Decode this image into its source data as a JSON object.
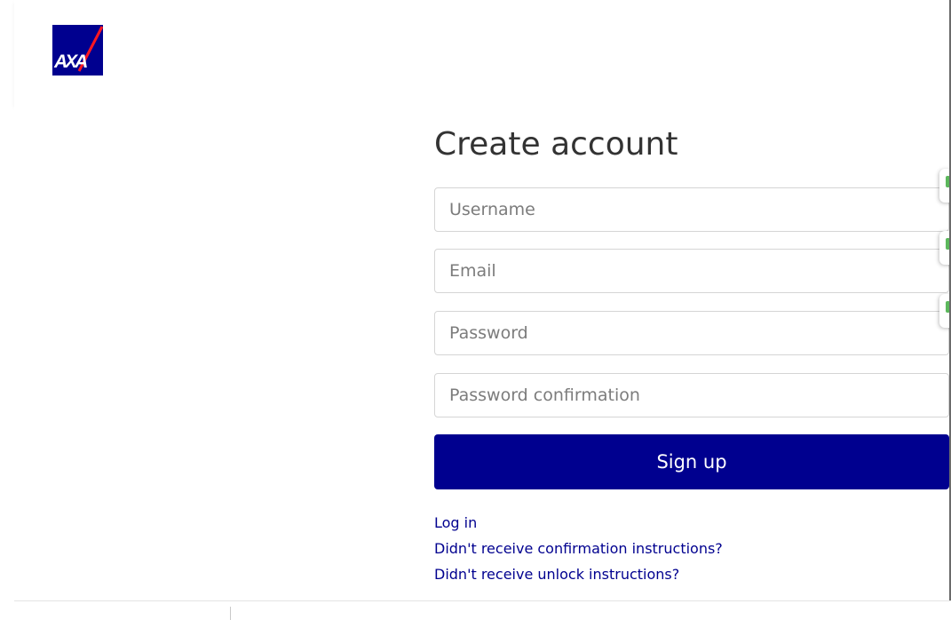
{
  "brand": {
    "logo_text": "AXA",
    "primary_color": "#00008f",
    "accent_color": "#ff1721"
  },
  "form": {
    "title": "Create account",
    "username_placeholder": "Username",
    "email_placeholder": "Email",
    "password_placeholder": "Password",
    "password_confirmation_placeholder": "Password confirmation",
    "submit_label": "Sign up"
  },
  "links": {
    "login": "Log in",
    "confirmation": "Didn't receive confirmation instructions?",
    "unlock": "Didn't receive unlock instructions?"
  },
  "extension_tabs": [
    {
      "icon": "password-manager-icon",
      "color": "#5cb85c"
    },
    {
      "icon": "password-manager-icon",
      "color": "#5cb85c"
    },
    {
      "icon": "password-manager-icon",
      "color": "#5cb85c"
    }
  ]
}
